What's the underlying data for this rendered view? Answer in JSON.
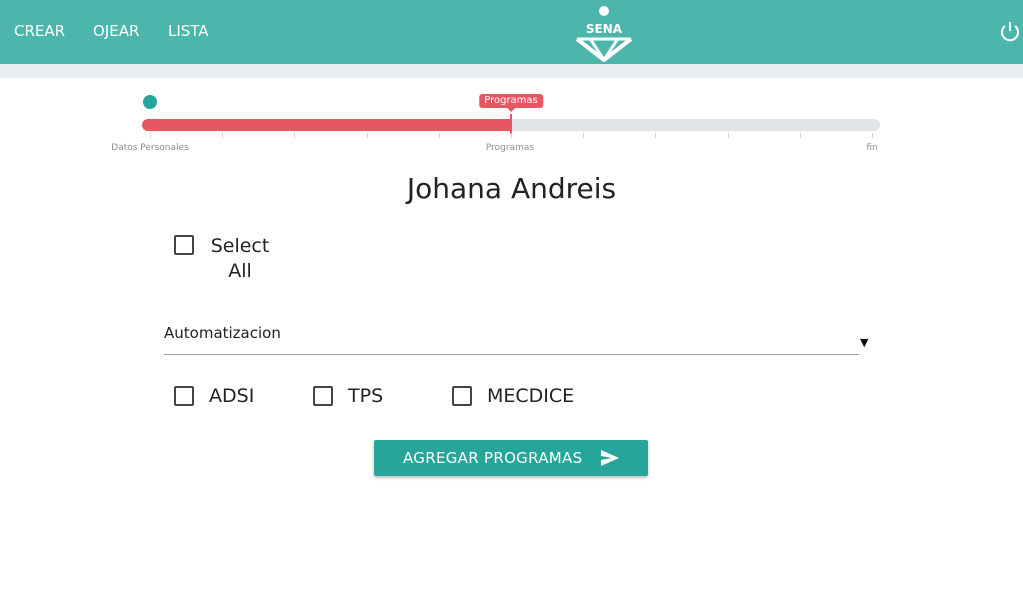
{
  "navbar": {
    "links": [
      "CREAR",
      "OJEAR",
      "LISTA"
    ],
    "logo_text": "SENA",
    "logo_icon": "sena-logo-icon",
    "power_icon": "power-icon",
    "bg_color": "#4db6ac"
  },
  "progress": {
    "current_label": "Programas",
    "value_fraction": 0.5,
    "tick_labels": [
      "Datos Personales",
      "Programas",
      "fin"
    ],
    "fill_color": "#e85662",
    "thumb_color": "#26a69a"
  },
  "person": {
    "name": "Johana Andreis"
  },
  "select_all": {
    "label": "Select All",
    "checked": false
  },
  "dropdown": {
    "selected": "Automatizacion",
    "caret": "▼"
  },
  "programs": [
    {
      "label": "ADSI",
      "checked": false
    },
    {
      "label": "TPS",
      "checked": false
    },
    {
      "label": "MECDICE",
      "checked": false
    }
  ],
  "submit": {
    "label": "AGREGAR PROGRAMAS",
    "icon": "send-icon",
    "color": "#26a69a"
  }
}
